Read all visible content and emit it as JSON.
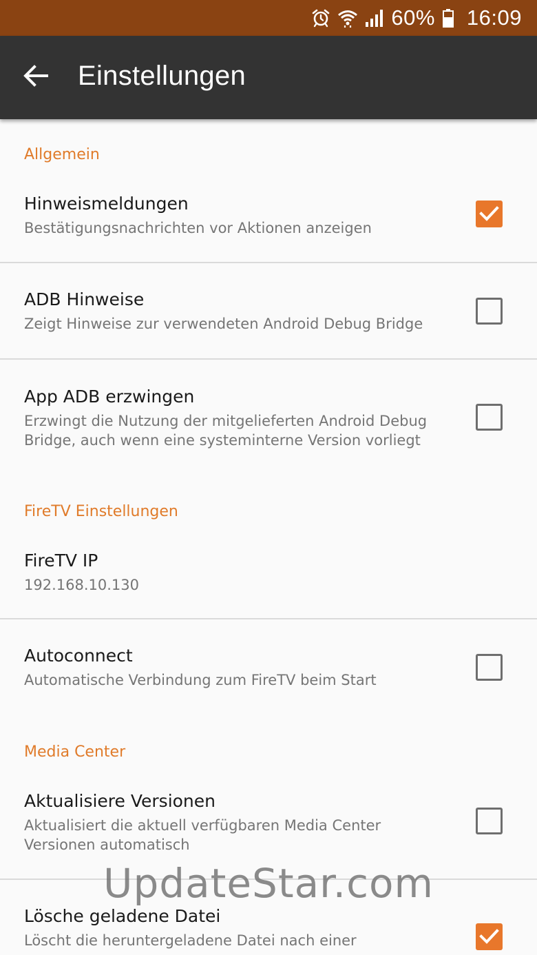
{
  "status_bar": {
    "battery": "60%",
    "time": "16:09",
    "icons": [
      "alarm-icon",
      "wifi-icon",
      "signal-icon",
      "battery-icon"
    ]
  },
  "app_bar": {
    "title": "Einstellungen",
    "back_icon": "arrow-left-icon"
  },
  "colors": {
    "status_bar": "#8a4312",
    "app_bar": "#333333",
    "accent": "#e8772b",
    "section_header": "#e07b2a",
    "background": "#fafafa"
  },
  "sections": [
    {
      "header": "Allgemein",
      "items": [
        {
          "title": "Hinweismeldungen",
          "summary": "Bestätigungsnachrichten vor Aktionen anzeigen",
          "checked": true
        },
        {
          "title": "ADB Hinweise",
          "summary": "Zeigt Hinweise zur verwendeten Android Debug Bridge",
          "checked": false
        },
        {
          "title": "App ADB erzwingen",
          "summary": "Erzwingt die Nutzung der mitgelieferten Android Debug Bridge, auch wenn eine systeminterne Version vorliegt",
          "checked": false
        }
      ]
    },
    {
      "header": "FireTV Einstellungen",
      "items": [
        {
          "title": "FireTV IP",
          "summary": "192.168.10.130"
        },
        {
          "title": "Autoconnect",
          "summary": "Automatische Verbindung zum FireTV beim Start",
          "checked": false
        }
      ]
    },
    {
      "header": "Media Center",
      "items": [
        {
          "title": "Aktualisiere Versionen",
          "summary": "Aktualisiert die aktuell verfügbaren Media Center Versionen automatisch",
          "checked": false
        },
        {
          "title": "Lösche geladene Datei",
          "summary": "Löscht die heruntergeladene Datei nach einer",
          "checked": true
        }
      ]
    }
  ],
  "watermark": "UpdateStar.com"
}
